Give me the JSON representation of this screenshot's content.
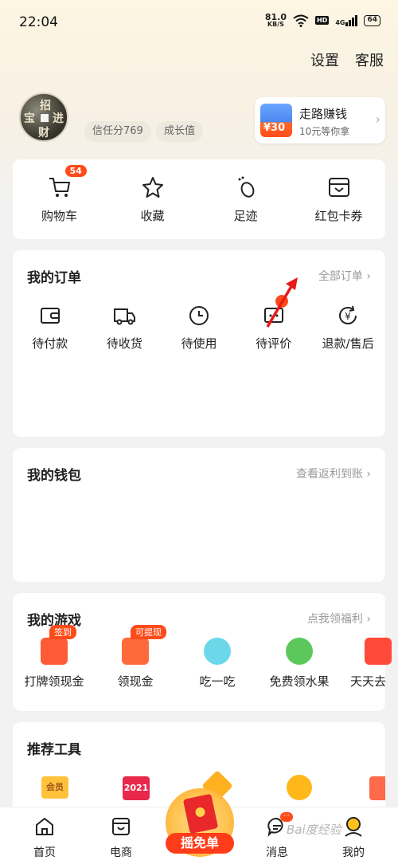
{
  "status_bar": {
    "time": "22:04",
    "net_speed_value": "81.0",
    "net_speed_unit": "KB/S",
    "hd": "HD",
    "signal": "4G",
    "battery": "64"
  },
  "header": {
    "settings": "设置",
    "service": "客服"
  },
  "profile": {
    "credit": "信任分769",
    "growth": "成长值",
    "promo_title": "走路赚钱",
    "promo_sub": "10元等你拿",
    "promo_amount": "¥30"
  },
  "quick_actions": [
    {
      "label": "购物车",
      "badge": "54",
      "icon": "cart-icon"
    },
    {
      "label": "收藏",
      "icon": "star-icon"
    },
    {
      "label": "足迹",
      "icon": "footprint-icon"
    },
    {
      "label": "红包卡券",
      "icon": "wallet-icon"
    }
  ],
  "orders": {
    "title": "我的订单",
    "link": "全部订单",
    "items": [
      {
        "label": "待付款",
        "icon": "wallet-icon"
      },
      {
        "label": "待收货",
        "icon": "truck-icon"
      },
      {
        "label": "待使用",
        "icon": "clock-icon"
      },
      {
        "label": "待评价",
        "icon": "comment-icon"
      },
      {
        "label": "退款/售后",
        "icon": "refund-icon"
      }
    ]
  },
  "wallet": {
    "title": "我的钱包",
    "link": "查看返利到账"
  },
  "games": {
    "title": "我的游戏",
    "link": "点我领福利",
    "items": [
      {
        "label": "打牌领现金",
        "tip": "签到"
      },
      {
        "label": "领现金",
        "tip": "可提现"
      },
      {
        "label": "吃一吃"
      },
      {
        "label": "免费领水果"
      },
      {
        "label": "天天去"
      }
    ]
  },
  "tools": {
    "title": "推荐工具",
    "items": [
      {
        "label": "会员"
      },
      {
        "label": "2021"
      }
    ]
  },
  "bottom_nav": {
    "home": "首页",
    "shop": "电商",
    "center": "摇免单",
    "messages": "消息",
    "mine": "我的"
  },
  "watermark": "Bai度经验",
  "colors": {
    "accent": "#ff4a1a",
    "card_bg": "#ffffff",
    "page_bg": "#f2f2f2"
  }
}
